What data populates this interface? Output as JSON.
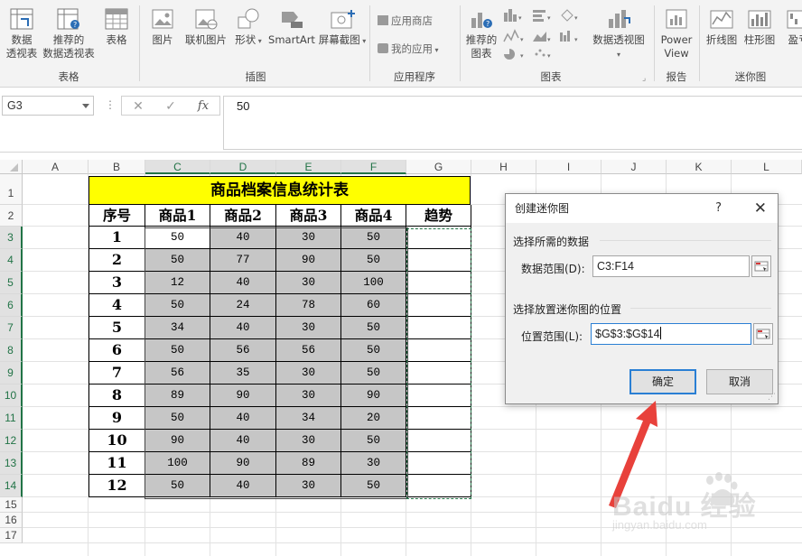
{
  "ribbon": {
    "tables_group": {
      "label": "表格",
      "items": [
        {
          "line1": "数据",
          "line2": "透视表"
        },
        {
          "line1": "推荐的",
          "line2": "数据透视表"
        },
        {
          "line1": "表格",
          "line2": ""
        }
      ]
    },
    "illustrations_group": {
      "label": "插图",
      "items": [
        "图片",
        "联机图片",
        "形状",
        "SmartArt",
        "屏幕截图"
      ]
    },
    "apps_group": {
      "label": "应用程序",
      "store": "应用商店",
      "my_apps": "我的应用"
    },
    "charts_group": {
      "label": "图表",
      "recommended": {
        "line1": "推荐的",
        "line2": "图表"
      },
      "pivot_chart": "数据透视图"
    },
    "reports_group": {
      "label": "报告",
      "power_view": {
        "line1": "Power",
        "line2": "View"
      }
    },
    "sparklines_group": {
      "label": "迷你图",
      "items": [
        "折线图",
        "柱形图",
        "盈亏"
      ]
    }
  },
  "formula_bar": {
    "name_box": "G3",
    "cancel": "✕",
    "enter": "✓",
    "fx": "fx",
    "value": "50"
  },
  "sheet": {
    "columns": [
      "A",
      "B",
      "C",
      "D",
      "E",
      "F",
      "G",
      "H",
      "I",
      "J",
      "K",
      "L"
    ],
    "rows": [
      "1",
      "2",
      "3",
      "4",
      "5",
      "6",
      "7",
      "8",
      "9",
      "10",
      "11",
      "12",
      "13",
      "14",
      "15",
      "16",
      "17"
    ],
    "title": "商品档案信息统计表",
    "headers": [
      "序号",
      "商品1",
      "商品2",
      "商品3",
      "商品4",
      "趋势"
    ],
    "data": [
      [
        1,
        50,
        40,
        30,
        50
      ],
      [
        2,
        50,
        77,
        90,
        50
      ],
      [
        3,
        12,
        40,
        30,
        100
      ],
      [
        4,
        50,
        24,
        78,
        60
      ],
      [
        5,
        34,
        40,
        30,
        50
      ],
      [
        6,
        50,
        56,
        56,
        50
      ],
      [
        7,
        56,
        35,
        30,
        50
      ],
      [
        8,
        89,
        90,
        30,
        90
      ],
      [
        9,
        50,
        40,
        34,
        20
      ],
      [
        10,
        90,
        40,
        30,
        50
      ],
      [
        11,
        100,
        90,
        89,
        30
      ],
      [
        12,
        50,
        40,
        30,
        50
      ]
    ]
  },
  "dialog": {
    "title": "创建迷你图",
    "help": "?",
    "close": "✕",
    "section1": "选择所需的数据",
    "data_range_label": "数据范围(D):",
    "data_range_value": "C3:F14",
    "section2": "选择放置迷你图的位置",
    "location_label": "位置范围(L):",
    "location_value": "$G$3:$G$14",
    "ok": "确定",
    "cancel": "取消"
  },
  "watermark": {
    "brand": "Baidu 经验",
    "url": "jingyan.baidu.com"
  },
  "colors": {
    "title_fill": "#ffff00",
    "data_fill": "#c6c6c6",
    "excel_green": "#217346",
    "arrow_red": "#e8413b"
  }
}
